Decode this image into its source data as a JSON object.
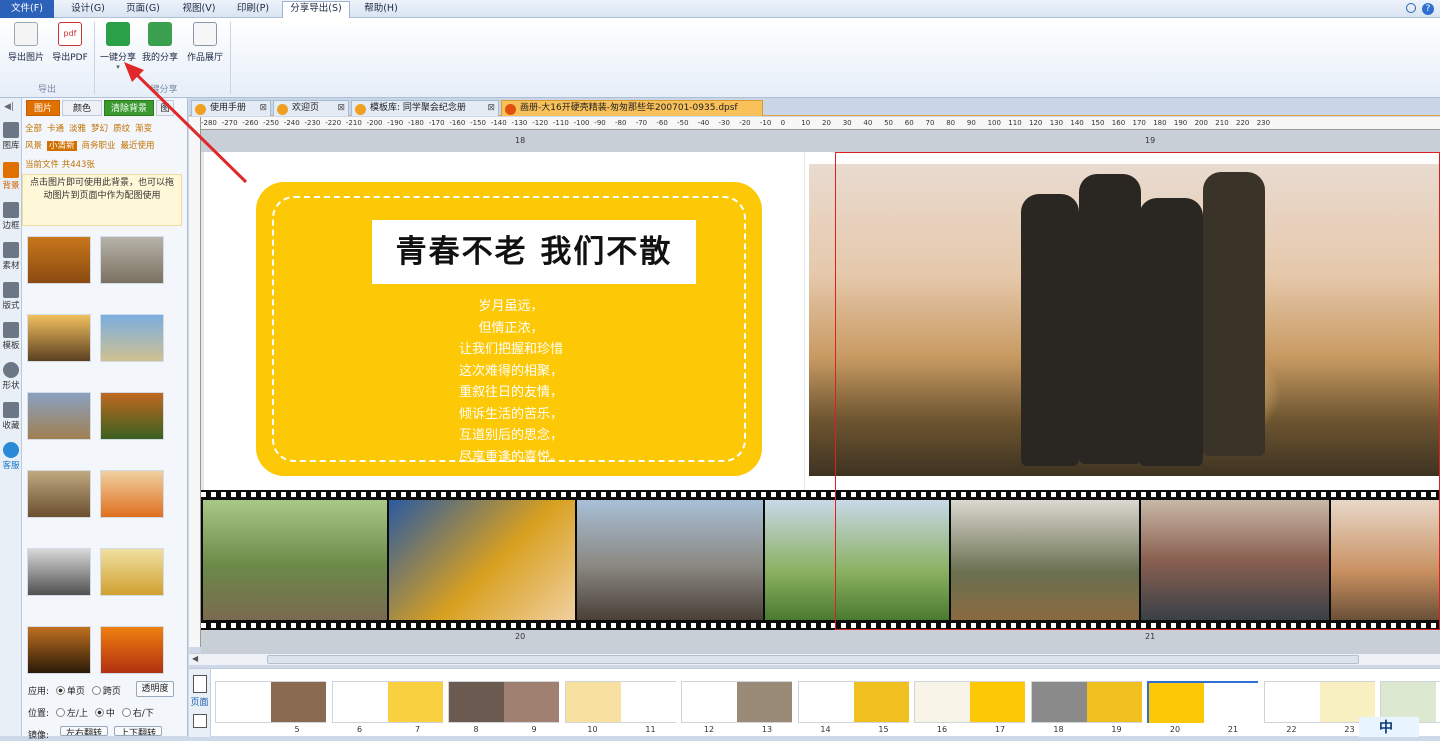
{
  "menu": {
    "items": [
      "文件(F)",
      "设计(G)",
      "页面(G)",
      "视图(V)",
      "印刷(P)",
      "分享导出(S)",
      "帮助(H)"
    ],
    "active_index": 5
  },
  "ribbon": {
    "buttons": {
      "export_image": "导出图片",
      "export_pdf": "导出PDF",
      "one_click_share": "一键分享",
      "my_share": "我的分享",
      "gallery": "作品展厅"
    },
    "groups": {
      "export": "导出",
      "share": "键分享"
    }
  },
  "left_tools": [
    "图库",
    "背景",
    "边框",
    "素材",
    "版式",
    "模板",
    "形状",
    "收藏",
    "客服"
  ],
  "panel": {
    "tabs": [
      "图片",
      "颜色",
      "清除背景",
      "图"
    ],
    "categories_row1": [
      "全部",
      "卡通",
      "淡雅",
      "梦幻",
      "质纹",
      "渐变"
    ],
    "categories_row2": [
      "风景",
      "小清新",
      "商务职业",
      "最近使用"
    ],
    "selected_category": "小清新",
    "count_text": "当前文件  共443张",
    "hint": "点击图片即可使用此背景，也可以拖动图片到页面中作为配图使用",
    "apply_label": "应用:",
    "apply_options": [
      "单页",
      "跨页"
    ],
    "transparency_button": "透明度",
    "position_label": "位置:",
    "position_options": [
      "左/上",
      "中",
      "右/下"
    ],
    "mirror_label": "镜像:",
    "mirror_buttons": [
      "左右翻转",
      "上下翻转"
    ]
  },
  "doc_tabs": [
    {
      "label": "使用手册",
      "active": false
    },
    {
      "label": "欢迎页",
      "active": false
    },
    {
      "label": "模板库: 同学聚会纪念册",
      "active": false
    },
    {
      "label": "画册-大16开硬壳精装-匆匆那些年200701-0935.dpsf",
      "active": true
    }
  ],
  "ruler_labels": [
    "-280",
    "-270",
    "-260",
    "-250",
    "-240",
    "-230",
    "-220",
    "-210",
    "-200",
    "-190",
    "-180",
    "-170",
    "-160",
    "-150",
    "-140",
    "-130",
    "-120",
    "-110",
    "-100",
    "-90",
    "-80",
    "-70",
    "-60",
    "-50",
    "-40",
    "-30",
    "-20",
    "-10",
    "0",
    "10",
    "20",
    "30",
    "40",
    "50",
    "60",
    "70",
    "80",
    "90",
    "100",
    "110",
    "120",
    "130",
    "140",
    "150",
    "160",
    "170",
    "180",
    "190",
    "200",
    "210",
    "220",
    "230"
  ],
  "page_numbers": {
    "left_top": "18",
    "right_top": "19",
    "left_bottom": "20",
    "right_bottom": "21"
  },
  "page": {
    "headline": "青春不老 我们不散",
    "poem": [
      "岁月虽远，",
      "但情正浓，",
      "让我们把握和珍惜",
      "这次难得的相聚，",
      "重叙往日的友情，",
      "倾诉生活的苦乐，",
      "互道别后的思念，",
      "尽享重逢的喜悦。"
    ]
  },
  "strip": {
    "tab_label": "页面",
    "numbers": [
      "5",
      "6",
      "7",
      "8",
      "9",
      "10",
      "11",
      "12",
      "13",
      "14",
      "15",
      "16",
      "17",
      "18",
      "19",
      "20",
      "21",
      "22",
      "23"
    ],
    "selected": "21",
    "corner_text": "中"
  },
  "colors": {
    "accent_yellow": "#fdc806",
    "ribbon_blue": "#2b61b8",
    "selection_red": "#e02020",
    "tab_orange": "#f8c15a"
  }
}
